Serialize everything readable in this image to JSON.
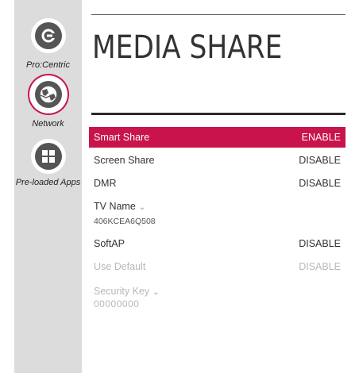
{
  "sidebar": {
    "items": [
      {
        "label": "Pro:Centric",
        "icon": "pro-centric-icon"
      },
      {
        "label": "Network",
        "icon": "network-globe-icon",
        "active": true
      },
      {
        "label": "Pre-loaded Apps",
        "icon": "apps-grid-icon"
      }
    ]
  },
  "page": {
    "title": "MEDIA SHARE"
  },
  "settings": {
    "smart_share": {
      "label": "Smart Share",
      "value": "ENABLE"
    },
    "screen_share": {
      "label": "Screen Share",
      "value": "DISABLE"
    },
    "dmr": {
      "label": "DMR",
      "value": "DISABLE"
    },
    "tv_name": {
      "label": "TV Name",
      "value": "406KCEA6Q508"
    },
    "softap": {
      "label": "SoftAP",
      "value": "DISABLE"
    },
    "use_default": {
      "label": "Use Default",
      "value": "DISABLE"
    },
    "security_key": {
      "label": "Security Key",
      "value": "00000000"
    }
  },
  "colors": {
    "accent": "#c8134b",
    "sidebar_bg": "#dcdcdc",
    "disabled_text": "#b8b8b8"
  }
}
